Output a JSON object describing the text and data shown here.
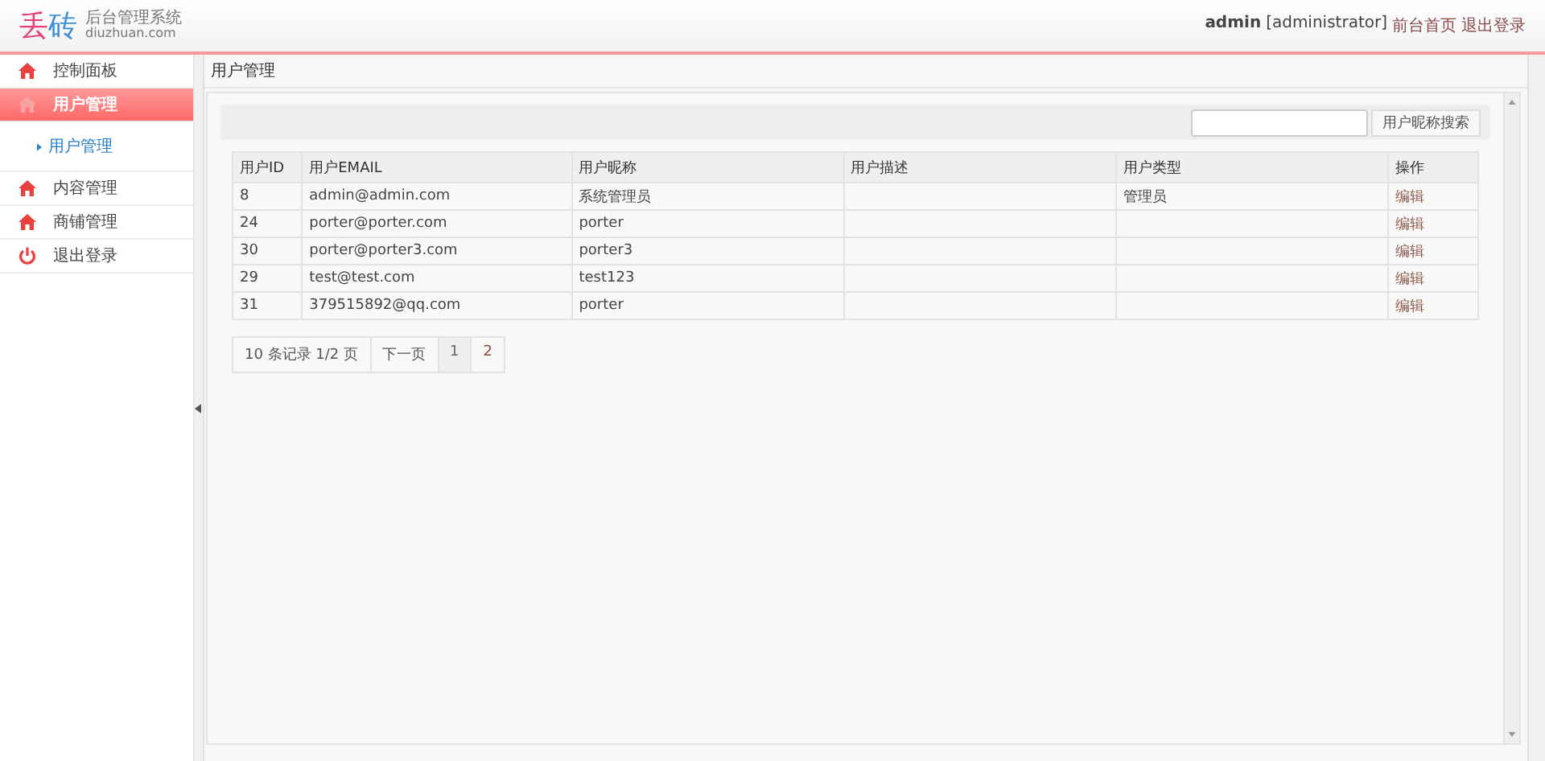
{
  "header": {
    "logo": {
      "chars": [
        {
          "text": "丢",
          "color": "#e8417a"
        },
        {
          "text": "砖",
          "color": "#3a8fd6"
        }
      ],
      "subtitle": "后台管理系统",
      "domain": "diuzhuan.com"
    },
    "user": {
      "name": "admin",
      "role": "[administrator]",
      "links": [
        "前台首页",
        "退出登录"
      ]
    }
  },
  "sidebar": {
    "items": [
      {
        "label": "控制面板",
        "kind": "section",
        "selected": false
      },
      {
        "label": "用户管理",
        "kind": "section",
        "selected": true,
        "children": [
          {
            "label": "用户管理",
            "selected": true
          }
        ]
      },
      {
        "label": "内容管理",
        "kind": "section",
        "selected": false
      },
      {
        "label": "商铺管理",
        "kind": "section",
        "selected": false
      },
      {
        "label": "退出登录",
        "kind": "logout",
        "selected": false
      }
    ]
  },
  "breadcrumb": "用户管理",
  "search": {
    "button": "用户昵称搜索"
  },
  "table": {
    "columns": [
      "用户ID",
      "用户EMAIL",
      "用户昵称",
      "用户描述",
      "用户类型",
      "操作"
    ],
    "rows": [
      {
        "cells": [
          "8",
          "admin@admin.com",
          "系统管理员",
          "",
          "管理员"
        ],
        "action": "编辑"
      },
      {
        "cells": [
          "24",
          "porter@porter.com",
          "porter",
          "",
          ""
        ],
        "action": "编辑"
      },
      {
        "cells": [
          "30",
          "porter@porter3.com",
          "porter3",
          "",
          ""
        ],
        "action": "编辑"
      },
      {
        "cells": [
          "29",
          "test@test.com",
          "test123",
          "",
          ""
        ],
        "action": "编辑"
      },
      {
        "cells": [
          "31",
          "379515892@qq.com",
          "porter",
          "",
          ""
        ],
        "action": "编辑"
      }
    ]
  },
  "pagination": {
    "summary": "10 条记录 1/2 页",
    "next": "下一页",
    "pages": [
      {
        "label": "1",
        "selected": true
      },
      {
        "label": "2",
        "selected": false
      }
    ]
  }
}
